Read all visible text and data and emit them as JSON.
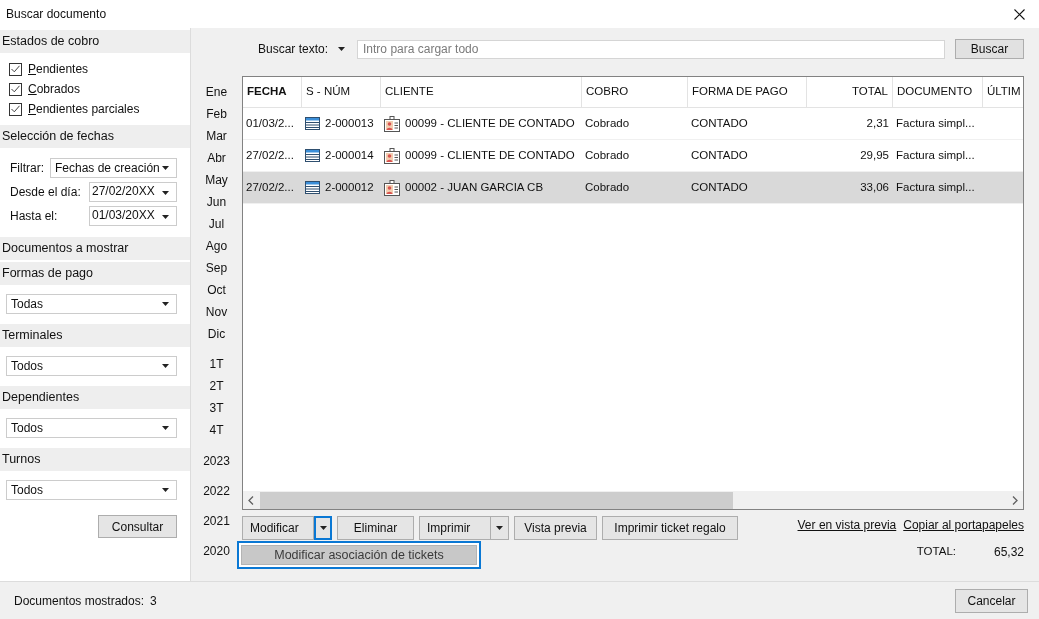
{
  "window": {
    "title": "Buscar documento"
  },
  "sidebar": {
    "payment_status": {
      "title": "Estados de cobro",
      "options": [
        {
          "label": "Pendientes",
          "checked": true
        },
        {
          "label": "Cobrados",
          "checked": true
        },
        {
          "label": "Pendientes parciales",
          "checked": true
        }
      ]
    },
    "date_selection": {
      "title": "Selección de fechas",
      "fields": [
        {
          "label": "Filtrar:",
          "value": "Fechas de creación",
          "kind": "select"
        },
        {
          "label": "Desde el día:",
          "value": "27/02/20XX",
          "kind": "date"
        },
        {
          "label": "Hasta el:",
          "value": "01/03/20XX",
          "kind": "date"
        }
      ]
    },
    "documents_heading": "Documentos a mostrar",
    "filter_groups": [
      {
        "title": "Formas de pago",
        "value": "Todas"
      },
      {
        "title": "Terminales",
        "value": "Todos"
      },
      {
        "title": "Dependientes",
        "value": "Todos"
      },
      {
        "title": "Turnos",
        "value": "Todos"
      }
    ],
    "query_button": "Consultar"
  },
  "periods": {
    "months": [
      "Ene",
      "Feb",
      "Mar",
      "Abr",
      "May",
      "Jun",
      "Jul",
      "Ago",
      "Sep",
      "Oct",
      "Nov",
      "Dic"
    ],
    "quarters": [
      "1T",
      "2T",
      "3T",
      "4T"
    ],
    "years": [
      "2023",
      "2022",
      "2021",
      "2020"
    ]
  },
  "search": {
    "label": "Buscar texto:",
    "placeholder": "Intro para cargar todo",
    "button": "Buscar"
  },
  "table": {
    "columns": [
      {
        "label": "FECHA",
        "kind": "text",
        "sorted": true
      },
      {
        "label": "S - NÚM",
        "kind": "document",
        "sorted": false
      },
      {
        "label": "CLIENTE",
        "kind": "client",
        "sorted": false
      },
      {
        "label": "COBRO",
        "kind": "text",
        "sorted": false
      },
      {
        "label": "FORMA DE PAGO",
        "kind": "text",
        "sorted": false
      },
      {
        "label": "TOTAL",
        "kind": "number",
        "sorted": false
      },
      {
        "label": "DOCUMENTO",
        "kind": "text",
        "sorted": false
      },
      {
        "label": "ÚLTIM",
        "kind": "text",
        "sorted": false
      }
    ],
    "rows": [
      {
        "selected": false,
        "cells": [
          "01/03/2...",
          "2-000013",
          "00099 - CLIENTE DE CONTADO",
          "Cobrado",
          "CONTADO",
          "2,31",
          "Factura simpl..."
        ]
      },
      {
        "selected": false,
        "cells": [
          "27/02/2...",
          "2-000014",
          "00099 - CLIENTE DE CONTADO",
          "Cobrado",
          "CONTADO",
          "29,95",
          "Factura simpl..."
        ]
      },
      {
        "selected": true,
        "cells": [
          "27/02/2...",
          "2-000012",
          "00002 - JUAN GARCIA CB",
          "Cobrado",
          "CONTADO",
          "33,06",
          "Factura simpl..."
        ]
      }
    ]
  },
  "actions": [
    {
      "label": "Modificar",
      "kind": "split",
      "focused": true,
      "menu": [
        {
          "label": "Modificar asociación de tickets",
          "selected": true
        }
      ]
    },
    {
      "label": "Eliminar",
      "kind": "button"
    },
    {
      "label": "Imprimir",
      "kind": "split",
      "focused": false
    },
    {
      "label": "Vista previa",
      "kind": "button"
    },
    {
      "label": "Imprimir ticket regalo",
      "kind": "button"
    }
  ],
  "links": [
    "Ver en vista previa",
    "Copiar al portapapeles"
  ],
  "total": {
    "label": "TOTAL:",
    "value": "65,32"
  },
  "status_bar": {
    "label": "Documentos mostrados:",
    "value": "3",
    "button": "Cancelar"
  }
}
